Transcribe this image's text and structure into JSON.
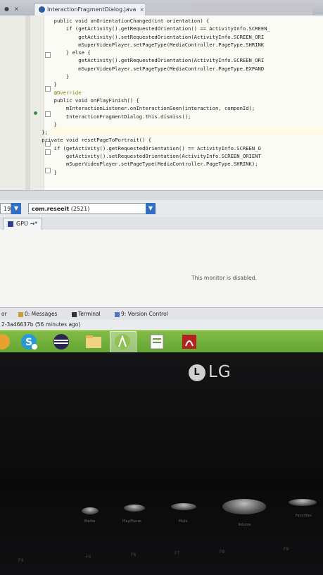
{
  "editor": {
    "tabs": [
      {
        "label": "InteractionFragmentDialog.java",
        "close": "×"
      }
    ],
    "code_lines": [
      "        public void onOrientationChanged(int orientation) {",
      "            if (getActivity().getRequestedOrientation() == ActivityInfo.SCREEN_",
      "                getActivity().setRequestedOrientation(ActivityInfo.SCREEN_ORI",
      "                mSuperVideoPlayer.setPageType(MediaController.PageType.SHRINK",
      "            } else {",
      "                getActivity().getRequestedOrientation(ActivityInfo.SCREEN_ORI",
      "                mSuperVideoPlayer.setPageType(MediaController.PageType.EXPAND",
      "            }",
      "        }",
      "",
      "        @Override",
      "        public void onPlayFinish() {",
      "            mInteractionListener.onInteractionSeen(interaction, componId);",
      "            InteractionFragmentDialog.this.dismiss();",
      "        }",
      "    };",
      "",
      "    private void resetPageToPortrait() {",
      "        if (getActivity().getRequestedOrientation() == ActivityInfo.SCREEN_O",
      "            getActivity().setRequestedOrientation(ActivityInfo.SCREEN_ORIENT",
      "            mSuperVideoPlayer.setPageType(MediaController.PageType.SHRINK);",
      "        }"
    ]
  },
  "devices": {
    "device_value": "19",
    "process_value": "com.reseeit",
    "process_pid": "(2521)"
  },
  "monitors": {
    "tab_label": "GPU",
    "tab_suffix": "→*",
    "disabled_message": "This monitor is disabled."
  },
  "tool_windows": [
    {
      "label": "or"
    },
    {
      "label": "0: Messages"
    },
    {
      "label": "Terminal"
    },
    {
      "label": "9: Version Control"
    }
  ],
  "status_bar": {
    "text": "2-3a46637b (56 minutes ago)"
  },
  "taskbar": {
    "apps": [
      "skype-icon",
      "eclipse-icon",
      "file-explorer-icon",
      "android-studio-icon",
      "notepad-icon",
      "pdf-reader-icon"
    ]
  },
  "monitor_brand": {
    "logo_letter": "L",
    "logo_text": "LG"
  },
  "keyboard": {
    "media_labels": [
      "Media",
      "Play/Pause",
      "Mute",
      "Volume",
      "Favorites"
    ],
    "fkeys": [
      "F4",
      "F5",
      "F6",
      "F7",
      "F8",
      "F9"
    ]
  },
  "colors": {
    "taskbar_green": "#6aaf2e",
    "tab_blue": "#2c6fd1",
    "editor_bg": "#fbfbf6"
  }
}
